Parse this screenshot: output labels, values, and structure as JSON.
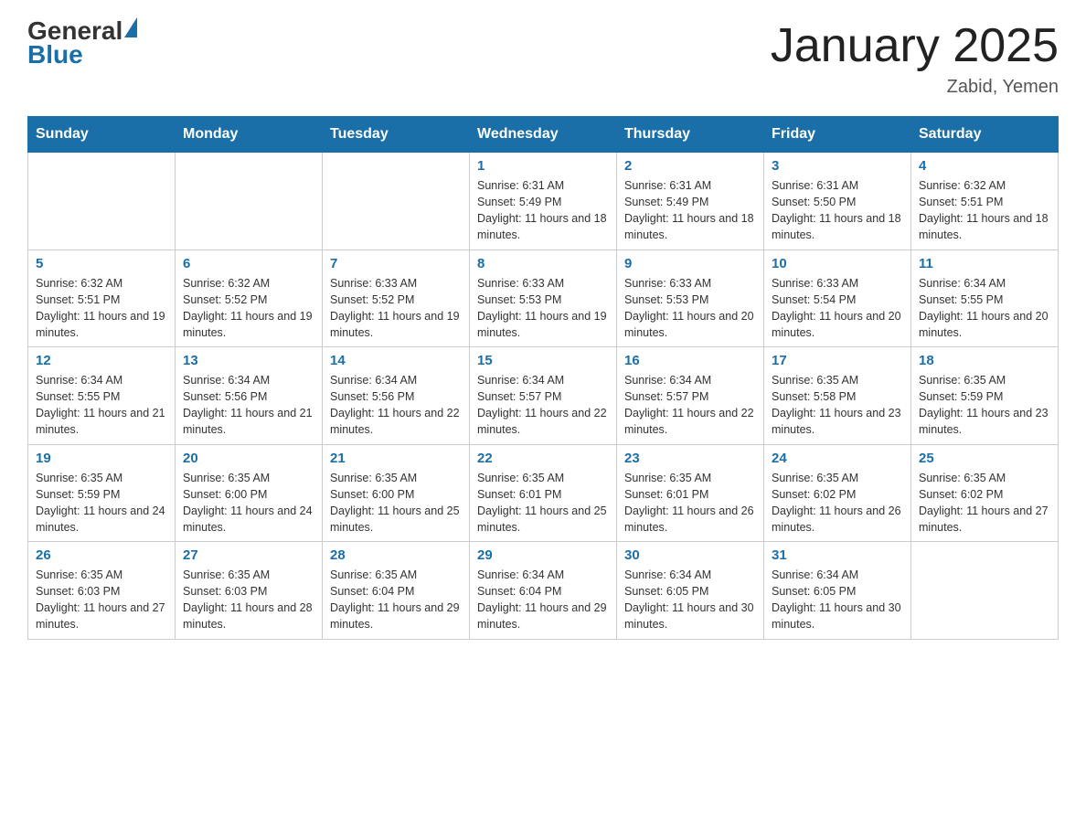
{
  "header": {
    "logo_general": "General",
    "logo_blue": "Blue",
    "title": "January 2025",
    "subtitle": "Zabid, Yemen"
  },
  "calendar": {
    "days_of_week": [
      "Sunday",
      "Monday",
      "Tuesday",
      "Wednesday",
      "Thursday",
      "Friday",
      "Saturday"
    ],
    "weeks": [
      [
        {
          "day": "",
          "info": ""
        },
        {
          "day": "",
          "info": ""
        },
        {
          "day": "",
          "info": ""
        },
        {
          "day": "1",
          "info": "Sunrise: 6:31 AM\nSunset: 5:49 PM\nDaylight: 11 hours and 18 minutes."
        },
        {
          "day": "2",
          "info": "Sunrise: 6:31 AM\nSunset: 5:49 PM\nDaylight: 11 hours and 18 minutes."
        },
        {
          "day": "3",
          "info": "Sunrise: 6:31 AM\nSunset: 5:50 PM\nDaylight: 11 hours and 18 minutes."
        },
        {
          "day": "4",
          "info": "Sunrise: 6:32 AM\nSunset: 5:51 PM\nDaylight: 11 hours and 18 minutes."
        }
      ],
      [
        {
          "day": "5",
          "info": "Sunrise: 6:32 AM\nSunset: 5:51 PM\nDaylight: 11 hours and 19 minutes."
        },
        {
          "day": "6",
          "info": "Sunrise: 6:32 AM\nSunset: 5:52 PM\nDaylight: 11 hours and 19 minutes."
        },
        {
          "day": "7",
          "info": "Sunrise: 6:33 AM\nSunset: 5:52 PM\nDaylight: 11 hours and 19 minutes."
        },
        {
          "day": "8",
          "info": "Sunrise: 6:33 AM\nSunset: 5:53 PM\nDaylight: 11 hours and 19 minutes."
        },
        {
          "day": "9",
          "info": "Sunrise: 6:33 AM\nSunset: 5:53 PM\nDaylight: 11 hours and 20 minutes."
        },
        {
          "day": "10",
          "info": "Sunrise: 6:33 AM\nSunset: 5:54 PM\nDaylight: 11 hours and 20 minutes."
        },
        {
          "day": "11",
          "info": "Sunrise: 6:34 AM\nSunset: 5:55 PM\nDaylight: 11 hours and 20 minutes."
        }
      ],
      [
        {
          "day": "12",
          "info": "Sunrise: 6:34 AM\nSunset: 5:55 PM\nDaylight: 11 hours and 21 minutes."
        },
        {
          "day": "13",
          "info": "Sunrise: 6:34 AM\nSunset: 5:56 PM\nDaylight: 11 hours and 21 minutes."
        },
        {
          "day": "14",
          "info": "Sunrise: 6:34 AM\nSunset: 5:56 PM\nDaylight: 11 hours and 22 minutes."
        },
        {
          "day": "15",
          "info": "Sunrise: 6:34 AM\nSunset: 5:57 PM\nDaylight: 11 hours and 22 minutes."
        },
        {
          "day": "16",
          "info": "Sunrise: 6:34 AM\nSunset: 5:57 PM\nDaylight: 11 hours and 22 minutes."
        },
        {
          "day": "17",
          "info": "Sunrise: 6:35 AM\nSunset: 5:58 PM\nDaylight: 11 hours and 23 minutes."
        },
        {
          "day": "18",
          "info": "Sunrise: 6:35 AM\nSunset: 5:59 PM\nDaylight: 11 hours and 23 minutes."
        }
      ],
      [
        {
          "day": "19",
          "info": "Sunrise: 6:35 AM\nSunset: 5:59 PM\nDaylight: 11 hours and 24 minutes."
        },
        {
          "day": "20",
          "info": "Sunrise: 6:35 AM\nSunset: 6:00 PM\nDaylight: 11 hours and 24 minutes."
        },
        {
          "day": "21",
          "info": "Sunrise: 6:35 AM\nSunset: 6:00 PM\nDaylight: 11 hours and 25 minutes."
        },
        {
          "day": "22",
          "info": "Sunrise: 6:35 AM\nSunset: 6:01 PM\nDaylight: 11 hours and 25 minutes."
        },
        {
          "day": "23",
          "info": "Sunrise: 6:35 AM\nSunset: 6:01 PM\nDaylight: 11 hours and 26 minutes."
        },
        {
          "day": "24",
          "info": "Sunrise: 6:35 AM\nSunset: 6:02 PM\nDaylight: 11 hours and 26 minutes."
        },
        {
          "day": "25",
          "info": "Sunrise: 6:35 AM\nSunset: 6:02 PM\nDaylight: 11 hours and 27 minutes."
        }
      ],
      [
        {
          "day": "26",
          "info": "Sunrise: 6:35 AM\nSunset: 6:03 PM\nDaylight: 11 hours and 27 minutes."
        },
        {
          "day": "27",
          "info": "Sunrise: 6:35 AM\nSunset: 6:03 PM\nDaylight: 11 hours and 28 minutes."
        },
        {
          "day": "28",
          "info": "Sunrise: 6:35 AM\nSunset: 6:04 PM\nDaylight: 11 hours and 29 minutes."
        },
        {
          "day": "29",
          "info": "Sunrise: 6:34 AM\nSunset: 6:04 PM\nDaylight: 11 hours and 29 minutes."
        },
        {
          "day": "30",
          "info": "Sunrise: 6:34 AM\nSunset: 6:05 PM\nDaylight: 11 hours and 30 minutes."
        },
        {
          "day": "31",
          "info": "Sunrise: 6:34 AM\nSunset: 6:05 PM\nDaylight: 11 hours and 30 minutes."
        },
        {
          "day": "",
          "info": ""
        }
      ]
    ]
  }
}
